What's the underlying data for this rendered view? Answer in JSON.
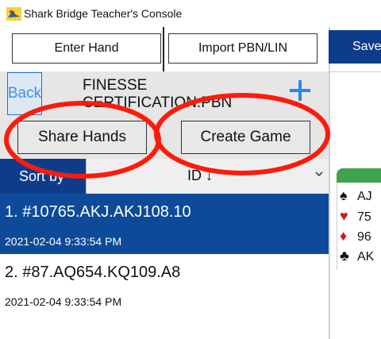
{
  "window": {
    "title": "Shark Bridge Teacher's Console"
  },
  "toolbar": {
    "enter_hand_label": "Enter Hand",
    "import_label": "Import PBN/LIN",
    "save_label": "Save"
  },
  "file_panel": {
    "back_label": "Back",
    "filename": "FINESSE CERTIFICATION.PBN",
    "add_icon": "plus-icon",
    "share_hands_label": "Share Hands",
    "create_game_label": "Create Game"
  },
  "sort": {
    "label": "Sort by",
    "selected": "ID ↓"
  },
  "hands": [
    {
      "title": "1. #10765.AKJ.AKJ108.10",
      "date": "2021-02-04 9:33:54 PM",
      "selected": true
    },
    {
      "title": "2. #87.AQ654.KQ109.A8",
      "date": "2021-02-04 9:33:54 PM",
      "selected": false
    }
  ],
  "preview": {
    "rows": [
      {
        "suit": "spade-icon",
        "glyph": "♠",
        "text": "AJ",
        "color": "#111111"
      },
      {
        "suit": "heart-icon",
        "glyph": "♥",
        "text": "75",
        "color": "#d11a1a"
      },
      {
        "suit": "diamond-icon",
        "glyph": "♦",
        "text": "96",
        "color": "#d11a1a"
      },
      {
        "suit": "club-icon",
        "glyph": "♣",
        "text": "AK",
        "color": "#111111"
      }
    ]
  },
  "colors": {
    "accent_blue": "#0d3d8a",
    "selected_row": "#0e4a9a",
    "annotation_red": "#ff1a0a",
    "green_tab": "#3fa34d"
  }
}
